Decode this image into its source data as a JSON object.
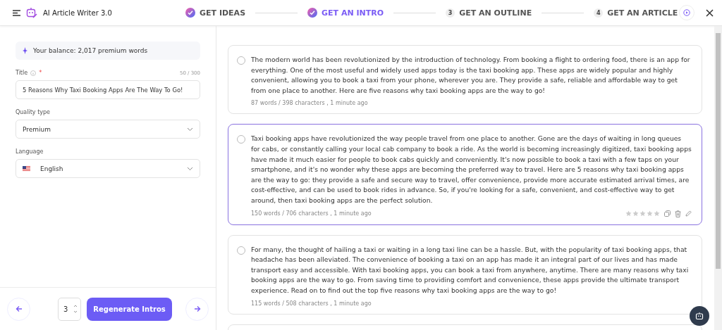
{
  "app": {
    "title": "AI Article Writer 3.0"
  },
  "steps": [
    {
      "label": "GET IDEAS",
      "done": true,
      "selected": false
    },
    {
      "label": "GET AN INTRO",
      "done": true,
      "selected": true
    },
    {
      "label": "GET AN OUTLINE",
      "number": "3",
      "done": false,
      "selected": false
    },
    {
      "label": "GET AN ARTICLE",
      "number": "4",
      "done": false,
      "selected": false
    }
  ],
  "sidebar": {
    "balance": "Your balance: 2,017 premium words",
    "title_label": "Title",
    "required_mark": "*",
    "counter": "50 / 300",
    "title_value": "5 Reasons Why Taxi Booking Apps Are The Way To Go!",
    "quality_label": "Quality type",
    "quality_value": "Premium",
    "language_label": "Language",
    "language_value": "English",
    "count_value": "3",
    "regenerate": "Regenerate Intros"
  },
  "intros": [
    {
      "text": "The modern world has been revolutionized by the introduction of technology. From booking a flight to ordering food, there is an app for everything. One of the most useful and widely used apps today is the taxi booking app. These apps are widely popular and highly convenient, allowing you to book a taxi from your phone, wherever you are. They provide a safe, reliable and affordable way to get from one place to another. Here are five reasons why taxi booking apps are the way to go!",
      "meta": "87 words / 398 characters , 1 minute ago",
      "selected": false
    },
    {
      "text": "Taxi booking apps have revolutionized the way people travel from one place to another. Gone are the days of waiting in long queues for cabs, or constantly calling your local cab company to book a ride. As the world is becoming increasingly digitized, taxi booking apps have made it much easier for people to book cabs quickly and conveniently. It's now possible to book a taxi with a few taps on your smartphone, and it's no wonder why these apps are becoming the preferred way to travel. Here are 5 reasons why taxi booking apps are the way to go: they provide a safe and secure way to travel, offer convenience, provide more accurate estimated arrival times, are cost-effective, and can be used to book rides in advance. So, if you're looking for a safe, convenient, and cost-effective way to get around, then taxi booking apps are the perfect solution.",
      "meta": "150 words / 706 characters , 1 minute ago",
      "selected": true,
      "stars": 0
    },
    {
      "text": "For many, the thought of hailing a taxi or waiting in a long taxi line can be a hassle. But, with the popularity of taxi booking apps, that headache has been alleviated. The convenience of booking a taxi on an app has made it an integral part of our lives and has made transport easy and accessible. With taxi booking apps, you can book a taxi from anywhere, anytime. There are many reasons why taxi booking apps are the way to go. From saving time to providing comfort and convenience, these apps provide the ultimate transport experience. Read on to find out the top five reasons why taxi booking apps are the way to go!",
      "meta": "115 words / 508 characters , 1 minute ago",
      "selected": false
    }
  ]
}
